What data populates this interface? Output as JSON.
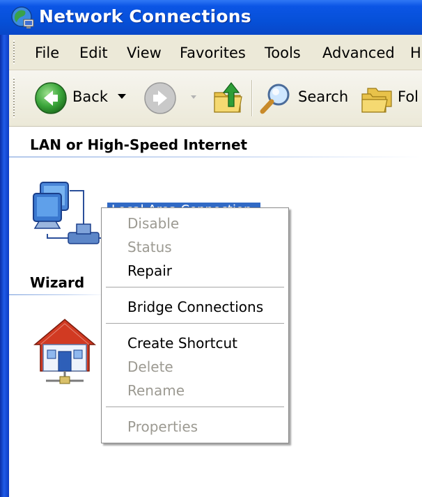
{
  "window": {
    "title": "Network Connections",
    "icon": "network-connections-icon"
  },
  "menubar": {
    "items": [
      {
        "label": "File"
      },
      {
        "label": "Edit"
      },
      {
        "label": "View"
      },
      {
        "label": "Favorites"
      },
      {
        "label": "Tools"
      },
      {
        "label": "Advanced"
      },
      {
        "label": "H"
      }
    ]
  },
  "toolbar": {
    "back_label": "Back",
    "search_label": "Search",
    "folders_label": "Fol",
    "icons": [
      "back-arrow-icon",
      "dropdown-arrow-icon",
      "forward-arrow-icon",
      "up-folder-icon",
      "search-magnifier-icon",
      "folders-icon"
    ]
  },
  "content": {
    "section_lan": "LAN or High-Speed Internet",
    "section_wizard": "Wizard",
    "selected_connection_label": "Local Area Connection"
  },
  "context_menu": {
    "items": [
      {
        "label": "Disable",
        "enabled": false
      },
      {
        "label": "Status",
        "enabled": false
      },
      {
        "label": "Repair",
        "enabled": true
      },
      {
        "label": "Bridge Connections",
        "enabled": true
      },
      {
        "label": "Create Shortcut",
        "enabled": true
      },
      {
        "label": "Delete",
        "enabled": false
      },
      {
        "label": "Rename",
        "enabled": false
      },
      {
        "label": "Properties",
        "enabled": false
      }
    ]
  },
  "colors": {
    "titlebar": "#0650d8",
    "menubar": "#ece9d8",
    "selection": "#316ac5",
    "disabled_text": "#9c9a92",
    "back_button": "#3aa53a"
  }
}
